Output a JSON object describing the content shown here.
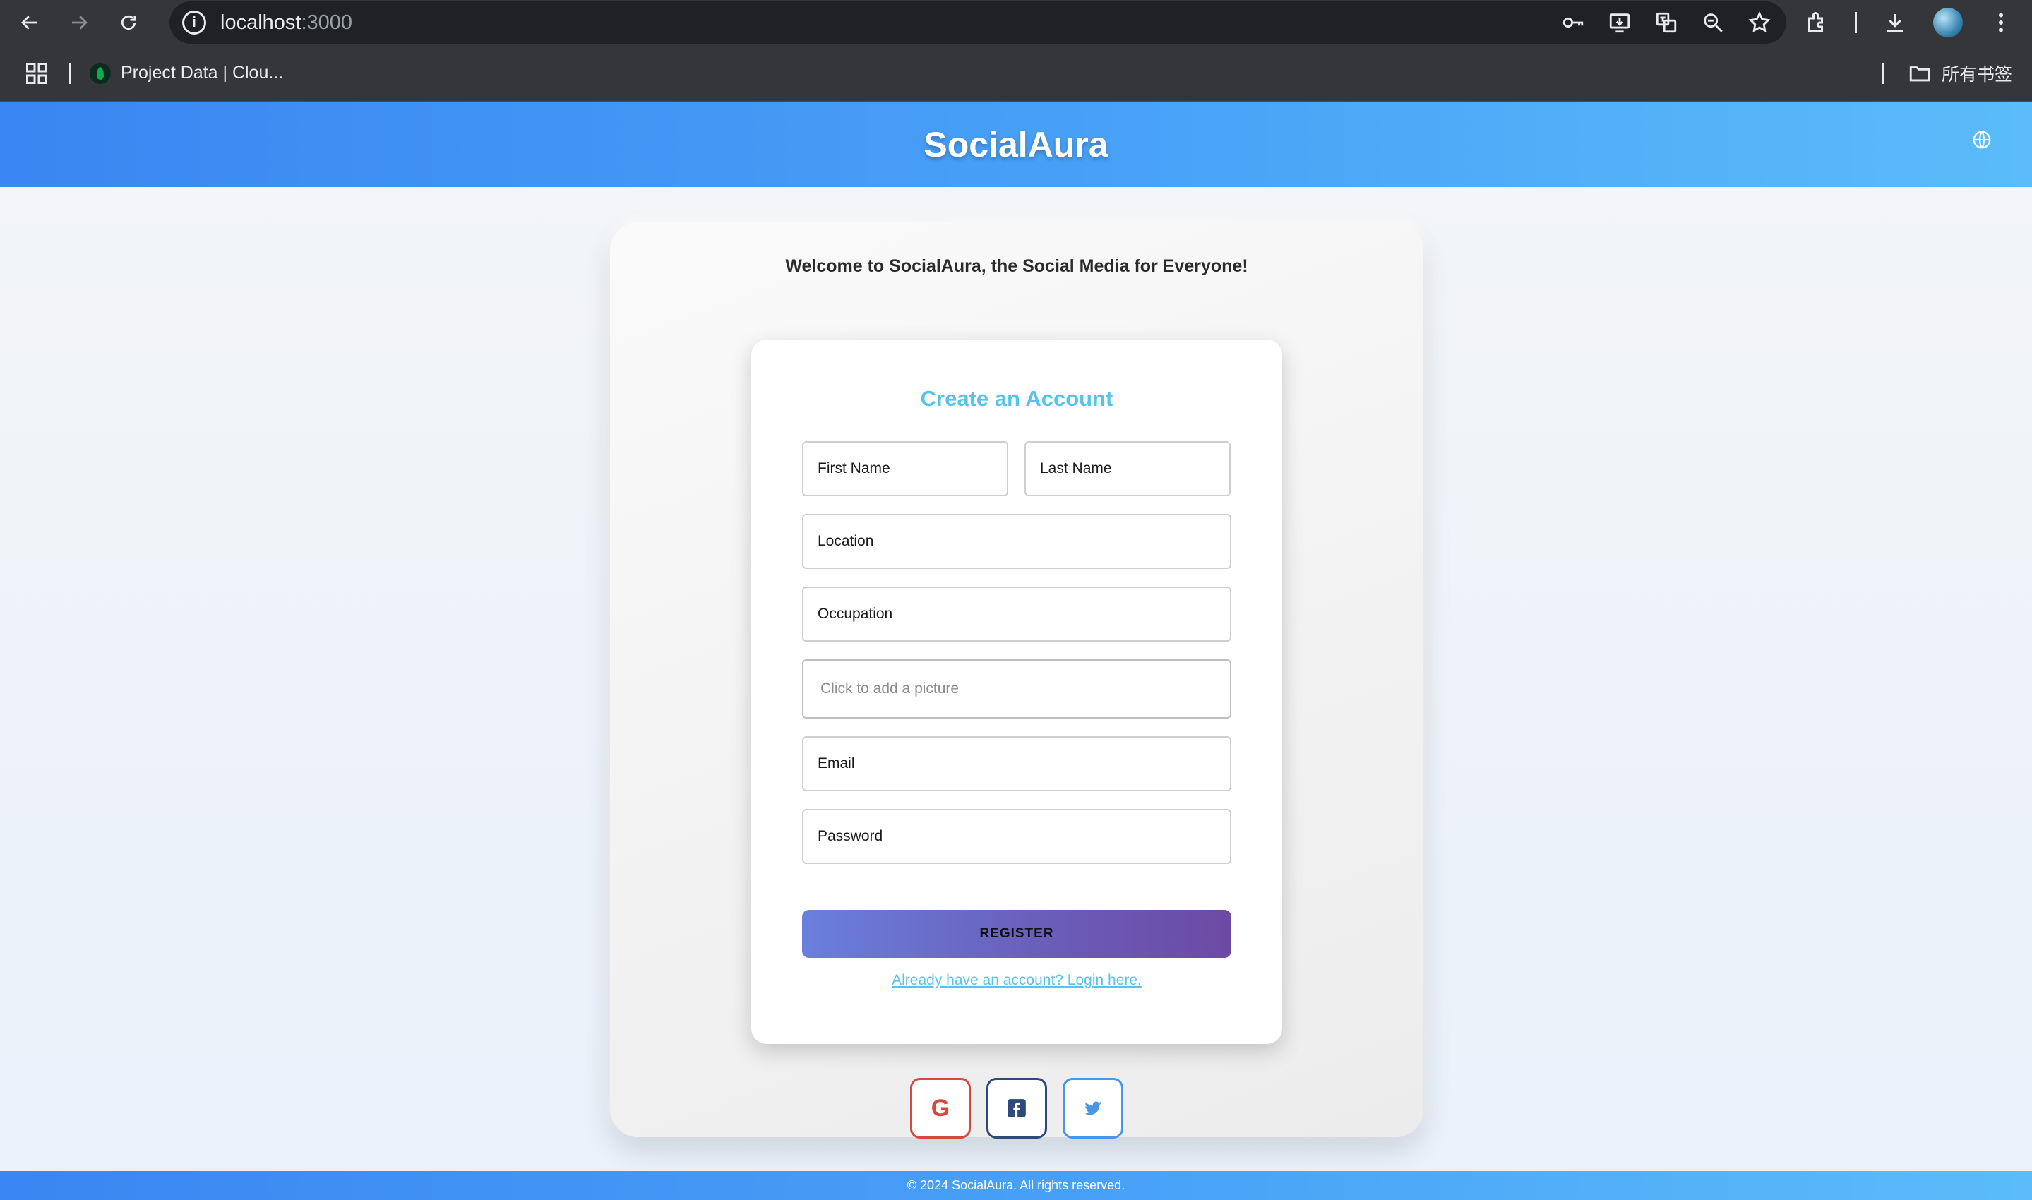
{
  "browser": {
    "url_host": "localhost",
    "url_port": ":3000",
    "bookmark_item": "Project Data | Clou...",
    "all_bookmarks_label": "所有书签"
  },
  "header": {
    "brand": "SocialAura"
  },
  "panel": {
    "welcome_text": "Welcome to SocialAura, the Social Media for Everyone!"
  },
  "form": {
    "title": "Create an Account",
    "first_name_label": "First Name",
    "last_name_label": "Last Name",
    "location_label": "Location",
    "occupation_label": "Occupation",
    "picture_placeholder": "Click to add a picture",
    "email_label": "Email",
    "password_label": "Password",
    "register_label": "REGISTER",
    "login_link": "Already have an account? Login here."
  },
  "social": {
    "google_letter": "G"
  },
  "footer": {
    "text": "© 2024 SocialAura. All rights reserved."
  },
  "colors": {
    "header_gradient_start": "#3a86f2",
    "header_gradient_end": "#5bbcf9",
    "title_accent": "#56c4ea",
    "register_gradient_start": "#6a7fdc",
    "register_gradient_end": "#6c4aa3",
    "google": "#d34a3e",
    "facebook": "#2e4a7d",
    "twitter": "#4a96e6"
  },
  "icons": [
    "back-arrow-icon",
    "forward-arrow-icon",
    "reload-icon",
    "site-info-icon",
    "password-key-icon",
    "install-icon",
    "translate-icon",
    "zoom-icon",
    "bookmark-star-icon",
    "extensions-icon",
    "download-icon",
    "profile-avatar",
    "menu-dots-icon",
    "apps-grid-icon",
    "folder-icon",
    "globe-icon",
    "google-icon",
    "facebook-icon",
    "twitter-icon"
  ]
}
